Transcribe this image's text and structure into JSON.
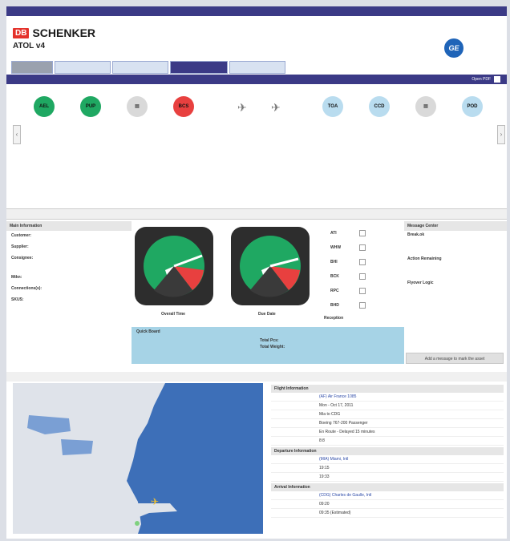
{
  "topbar": {
    "left": "",
    "right": ""
  },
  "brand": {
    "db": "DB",
    "name": "SCHENKER",
    "app": "ATOL v4",
    "ge": "GE"
  },
  "tabs": [],
  "subbar": {
    "open_pdf": "Open PDF"
  },
  "timeline": {
    "nodes": [
      {
        "code": "AEL",
        "color": "green"
      },
      {
        "code": "PUP",
        "color": "green"
      },
      {
        "code": "",
        "color": "gray"
      },
      {
        "code": "BCS",
        "color": "red"
      },
      {
        "code": "",
        "color": "plane"
      },
      {
        "code": "",
        "color": "plane"
      },
      {
        "code": "TOA",
        "color": "light"
      },
      {
        "code": "CCD",
        "color": "light"
      },
      {
        "code": "",
        "color": "gray"
      },
      {
        "code": "POD",
        "color": "light"
      }
    ]
  },
  "dials": {
    "left_label": "Overall Time",
    "right_label": "Due Date",
    "reception_label": "Reception"
  },
  "checks": [
    "ATI",
    "WHW",
    "BHI",
    "BCK",
    "RPC",
    "BHD"
  ],
  "main_info": {
    "title": "Main Information",
    "rows": [
      {
        "k": "Customer:",
        "v": ""
      },
      {
        "k": "Supplier:",
        "v": ""
      },
      {
        "k": "Consignee:",
        "v": ""
      },
      {
        "k": "Mtkn:",
        "v": ""
      },
      {
        "k": "Connections(s):",
        "v": ""
      },
      {
        "k": "SKUS:",
        "v": ""
      }
    ]
  },
  "quick_board": {
    "title": "Quick Board",
    "total_pcs_label": "Total Pcs:",
    "total_weight_label": "Total Weight:",
    "pcs_value": "",
    "weight_value": ""
  },
  "message_center": {
    "title": "Message Center",
    "items": [
      {
        "title": "Break.ok",
        "time": "",
        "text": ""
      },
      {
        "title": "Action Remaining",
        "time": "",
        "text": ""
      },
      {
        "title": "Flyover Logic",
        "time": "",
        "text": ""
      }
    ],
    "button": "Add a message to mark the asset"
  },
  "flight_bar": {
    "label": ""
  },
  "flight_info": {
    "section1": "Flight Information",
    "rows1": [
      {
        "k": "",
        "v": "(AF) Air France 1085",
        "link": true
      },
      {
        "k": "",
        "v": "Mon - Oct 17, 2011",
        "link": false
      },
      {
        "k": "",
        "v": "Mia to CDG",
        "link": false
      },
      {
        "k": "",
        "v": "Boeing 767-200 Passenger",
        "link": false
      },
      {
        "k": "",
        "v": "En Route - Delayed 15 minutes",
        "link": false
      },
      {
        "k": "",
        "v": "8:8",
        "link": false
      }
    ],
    "section2": "Departure Information",
    "rows2": [
      {
        "k": "",
        "v": "(MIA) Miami, Intl",
        "link": true
      },
      {
        "k": "",
        "v": "19:15",
        "link": false
      },
      {
        "k": "",
        "v": "19:33",
        "link": false
      }
    ],
    "section3": "Arrival Information",
    "rows3": [
      {
        "k": "",
        "v": "(CDG) Charles de Gaulle, Intl",
        "link": true
      },
      {
        "k": "",
        "v": "09:20",
        "link": false
      },
      {
        "k": "",
        "v": "09:35 (Estimated)",
        "link": false
      }
    ]
  },
  "colors": {
    "nav": "#3b3a86",
    "green": "#1fa862",
    "red": "#e8403f",
    "light_blue": "#b9dcef",
    "quick_board": "#a6d3e6",
    "map_water": "#3d6fb8"
  }
}
